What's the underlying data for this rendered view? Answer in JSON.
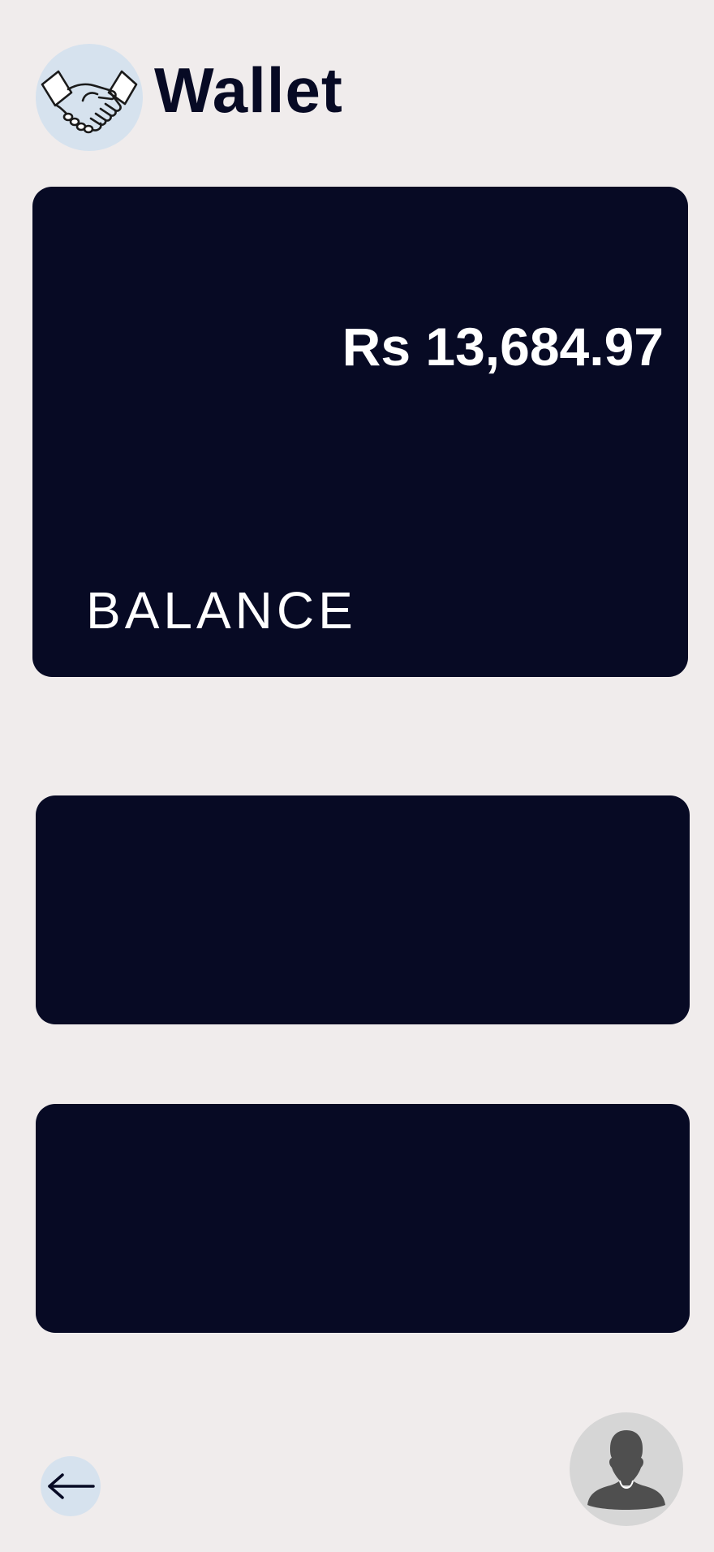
{
  "header": {
    "title": "Wallet",
    "logo_icon": "handshake-icon"
  },
  "balance_card": {
    "amount": "Rs 13,684.97",
    "label": "BALANCE"
  },
  "navigation": {
    "back_icon": "arrow-left-icon",
    "profile_icon": "user-avatar-icon"
  },
  "colors": {
    "background": "#f0ecec",
    "card": "#070a24",
    "logo_bg": "#d6e2ee",
    "avatar_bg": "#d6d6d6",
    "text_on_card": "#ffffff"
  }
}
